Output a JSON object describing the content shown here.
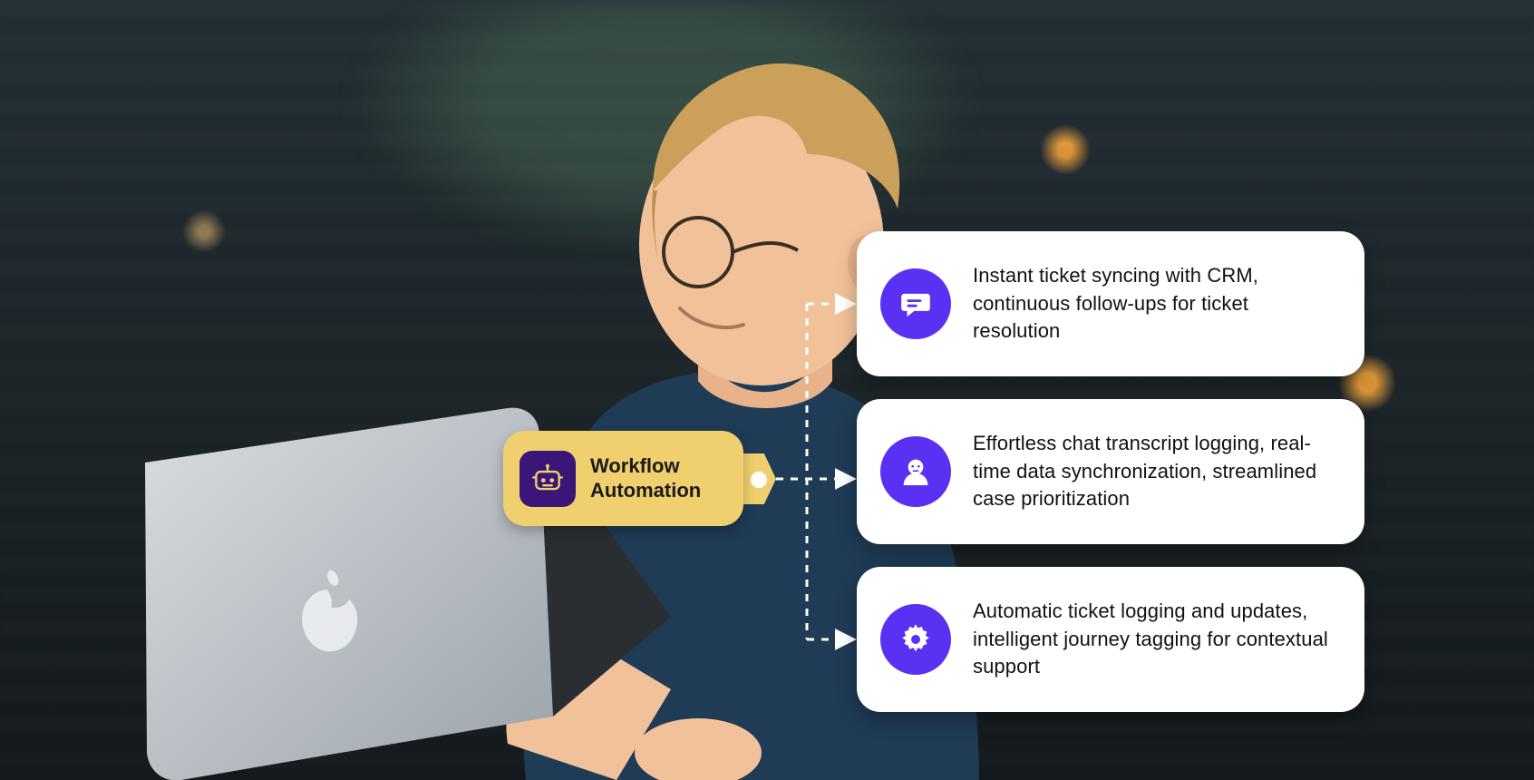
{
  "source": {
    "label": "Workflow\nAutomation",
    "icon": "robot-icon"
  },
  "cards": [
    {
      "icon": "chat-icon",
      "text": "Instant ticket syncing with CRM, continuous follow-ups for ticket resolution"
    },
    {
      "icon": "person-icon",
      "text": "Effortless chat transcript logging, real-time data synchronization, streamlined case prioritization"
    },
    {
      "icon": "gear-icon",
      "text": "Automatic ticket logging and updates, intelligent journey tagging for contextual support"
    }
  ],
  "colors": {
    "accent_purple": "#5a30f2",
    "chip_yellow": "#f0cf6e",
    "chip_icon_bg": "#3a1678"
  }
}
